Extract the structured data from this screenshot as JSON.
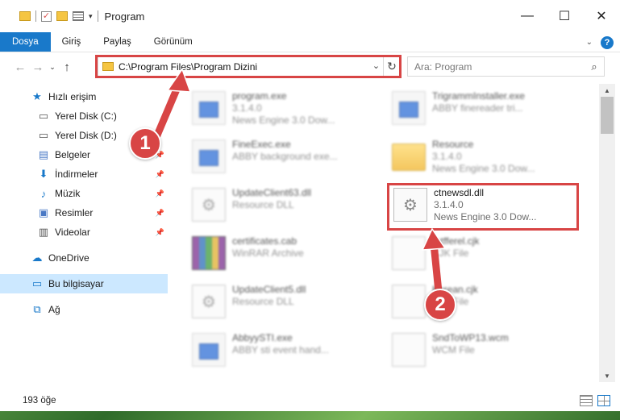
{
  "window": {
    "title": "Program"
  },
  "ribbon": {
    "tabs": [
      "Dosya",
      "Giriş",
      "Paylaş",
      "Görünüm"
    ]
  },
  "address": {
    "path": "C:\\Program Files\\Program Dizini"
  },
  "search": {
    "placeholder": "Ara: Program"
  },
  "sidebar": {
    "items": [
      {
        "label": "Hızlı erişim"
      },
      {
        "label": "Yerel Disk (C:)"
      },
      {
        "label": "Yerel Disk (D:)"
      },
      {
        "label": "Belgeler"
      },
      {
        "label": "İndirmeler"
      },
      {
        "label": "Müzik"
      },
      {
        "label": "Resimler"
      },
      {
        "label": "Videolar"
      },
      {
        "label": "OneDrive"
      },
      {
        "label": "Bu bilgisayar"
      },
      {
        "label": "Ağ"
      }
    ]
  },
  "files": [
    {
      "name": "program.exe",
      "line1": "3.1.4.0",
      "line2": "News Engine 3.0 Dow..."
    },
    {
      "name": "TrigrammInstaller.exe",
      "line1": "ABBY finereader tri...",
      "line2": ""
    },
    {
      "name": "FineExec.exe",
      "line1": "ABBY background exe...",
      "line2": ""
    },
    {
      "name": "Resource",
      "line1": "3.1.4.0",
      "line2": "News Engine 3.0 Dow..."
    },
    {
      "name": "UpdateClient63.dll",
      "line1": "Resource DLL",
      "line2": ""
    },
    {
      "name": "ctnewsdl.dll",
      "line1": "3.1.4.0",
      "line2": "News Engine 3.0 Dow..."
    },
    {
      "name": "certificates.cab",
      "line1": "WinRAR Archive",
      "line2": ""
    },
    {
      "name": "ratfferel.cjk",
      "line1": "CJK File",
      "line2": ""
    },
    {
      "name": "UpdateClient5.dll",
      "line1": "Resource DLL",
      "line2": ""
    },
    {
      "name": "Korean.cjk",
      "line1": "CJK File",
      "line2": ""
    },
    {
      "name": "AbbyySTI.exe",
      "line1": "ABBY sti event hand...",
      "line2": ""
    },
    {
      "name": "SndToWP13.wcm",
      "line1": "WCM File",
      "line2": ""
    }
  ],
  "status": {
    "count": "193 öğe"
  },
  "annotations": {
    "badge1": "1",
    "badge2": "2"
  },
  "colors": {
    "accent": "#1979ca",
    "highlight": "#d84545"
  }
}
